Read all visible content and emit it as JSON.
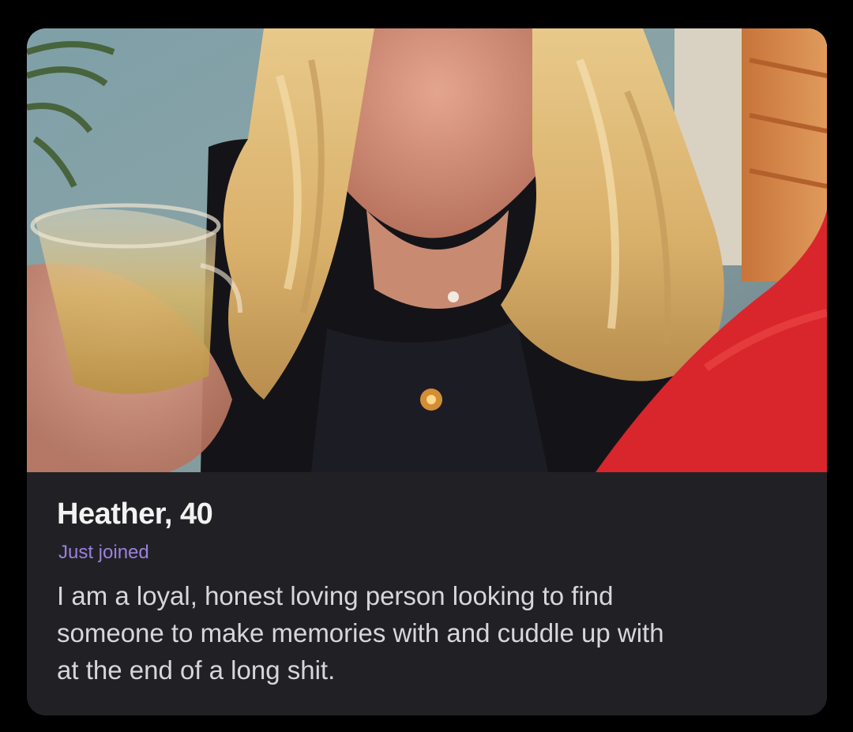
{
  "profile": {
    "name_age": "Heather, 40",
    "status": "Just joined",
    "bio_lines": [
      "I am a loyal, honest loving person looking to find",
      "someone to make memories with and cuddle up with",
      "at the end of a long shit."
    ]
  },
  "colors": {
    "page_background": "#000000",
    "card_background": "#212125",
    "status_accent": "#9d7fe0",
    "name_text": "#f2f2f2",
    "bio_text": "#d7d7d9"
  }
}
